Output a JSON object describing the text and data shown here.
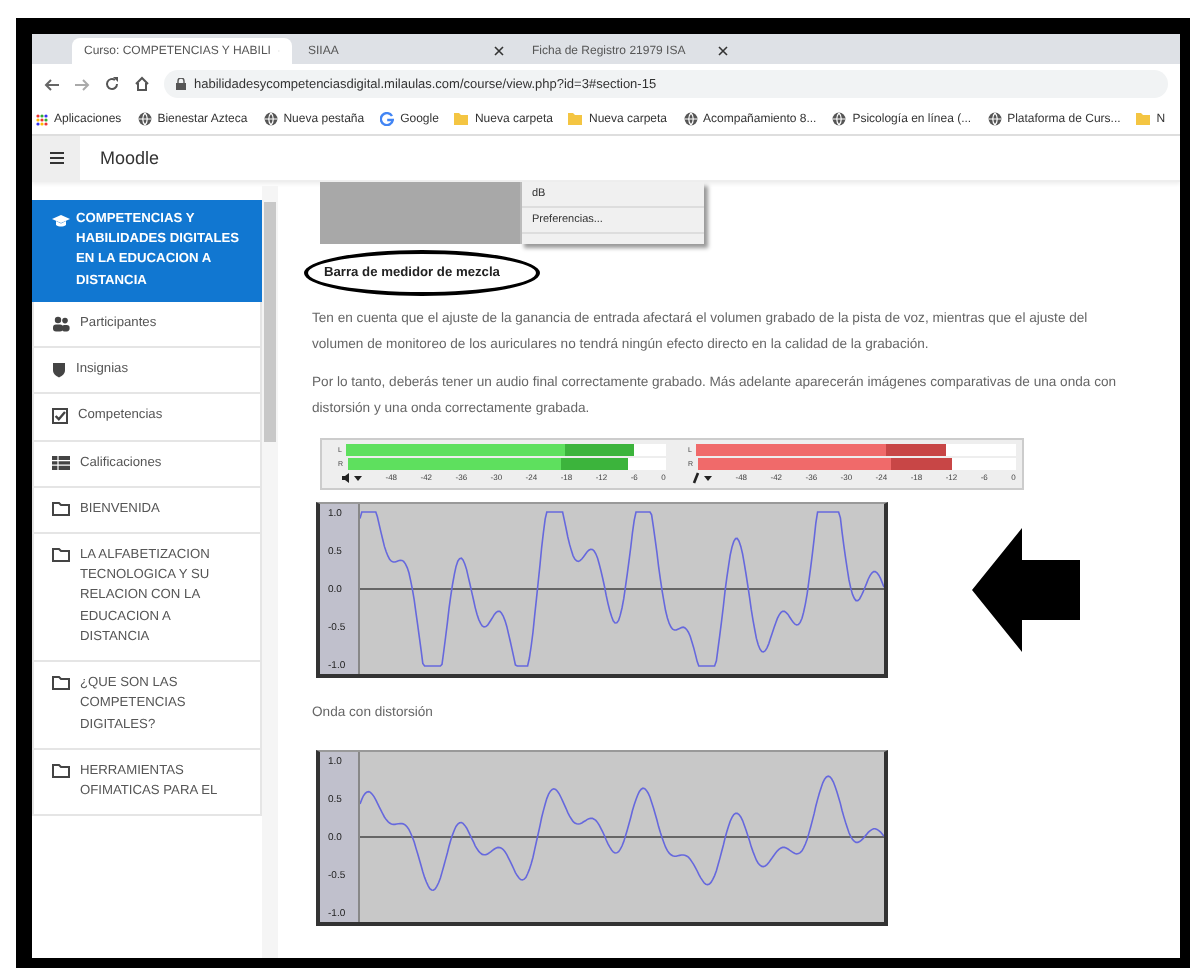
{
  "browser": {
    "tabs": [
      {
        "label": "Curso: COMPETENCIAS Y HABILI",
        "selected": true
      },
      {
        "label": "SIIAA",
        "selected": false
      },
      {
        "label": "Ficha de Registro 21979 ISA",
        "selected": false
      }
    ],
    "url": "habilidadesycompetenciasdigital.milaulas.com/course/view.php?id=3#section-15",
    "bookmarks": [
      {
        "label": "Aplicaciones",
        "kind": "apps"
      },
      {
        "label": "Bienestar Azteca",
        "kind": "globe"
      },
      {
        "label": "Nueva pestaña",
        "kind": "globe"
      },
      {
        "label": "Google",
        "kind": "google"
      },
      {
        "label": "Nueva carpeta",
        "kind": "folder"
      },
      {
        "label": "Nueva carpeta",
        "kind": "folder"
      },
      {
        "label": "Acompañamiento 8...",
        "kind": "globe"
      },
      {
        "label": "Psicología en línea (...",
        "kind": "globe"
      },
      {
        "label": "Plataforma de Curs...",
        "kind": "globe"
      },
      {
        "label": "N",
        "kind": "folder"
      }
    ]
  },
  "header": {
    "title": "Moodle"
  },
  "sidebar": {
    "course": "COMPETENCIAS Y HABILIDADES DIGITALES EN LA EDUCACION A DISTANCIA",
    "items": [
      {
        "label": "Participantes",
        "kind": "people"
      },
      {
        "label": "Insignias",
        "kind": "shield"
      },
      {
        "label": "Competencias",
        "kind": "check"
      },
      {
        "label": "Calificaciones",
        "kind": "table"
      },
      {
        "label": "BIENVENIDA",
        "kind": "folder"
      },
      {
        "label": "LA ALFABETIZACION TECNOLOGICA Y SU RELACION CON LA EDUCACION A DISTANCIA",
        "kind": "folder"
      },
      {
        "label": "¿QUE SON LAS COMPETENCIAS DIGITALES?",
        "kind": "folder"
      },
      {
        "label": "HERRAMIENTAS OFIMATICAS PARA EL",
        "kind": "folder"
      }
    ]
  },
  "content": {
    "menu_image": {
      "items": [
        "dB",
        "Preferencias..."
      ]
    },
    "heading": "Barra de medidor de mezcla",
    "paragraphs": [
      "Ten en cuenta que el ajuste de la ganancia de entrada afectará el volumen grabado de la pista de voz, mientras que el ajuste del volumen de monitoreo de los auriculares no tendrá ningún efecto directo en la calidad de la grabación.",
      "Por lo tanto, deberás tener un audio final correctamente grabado. Más adelante aparecerán imágenes comparativas de una onda con distorsión y una onda correctamente grabada."
    ],
    "meters": [
      {
        "kind": "playback",
        "channels": [
          {
            "label": "L",
            "level": 0.9
          },
          {
            "label": "R",
            "level": 0.88
          }
        ],
        "scale": [
          "-48",
          "-42",
          "-36",
          "-30",
          "-24",
          "-18",
          "-12",
          "-6",
          "0"
        ]
      },
      {
        "kind": "recording",
        "channels": [
          {
            "label": "L",
            "level": 0.78
          },
          {
            "label": "R",
            "level": 0.8
          }
        ],
        "scale": [
          "-48",
          "-42",
          "-36",
          "-30",
          "-24",
          "-18",
          "-12",
          "-6",
          "0"
        ]
      }
    ],
    "waves": [
      {
        "kind": "clipped",
        "ticks": [
          "1.0",
          "0.5",
          "0.0",
          "-0.5",
          "-1.0"
        ]
      },
      {
        "caption": "Onda con distorsión",
        "kind": "normal",
        "ticks": [
          "1.0",
          "0.5",
          "0.0",
          "-0.5",
          "-1.0"
        ]
      }
    ]
  }
}
